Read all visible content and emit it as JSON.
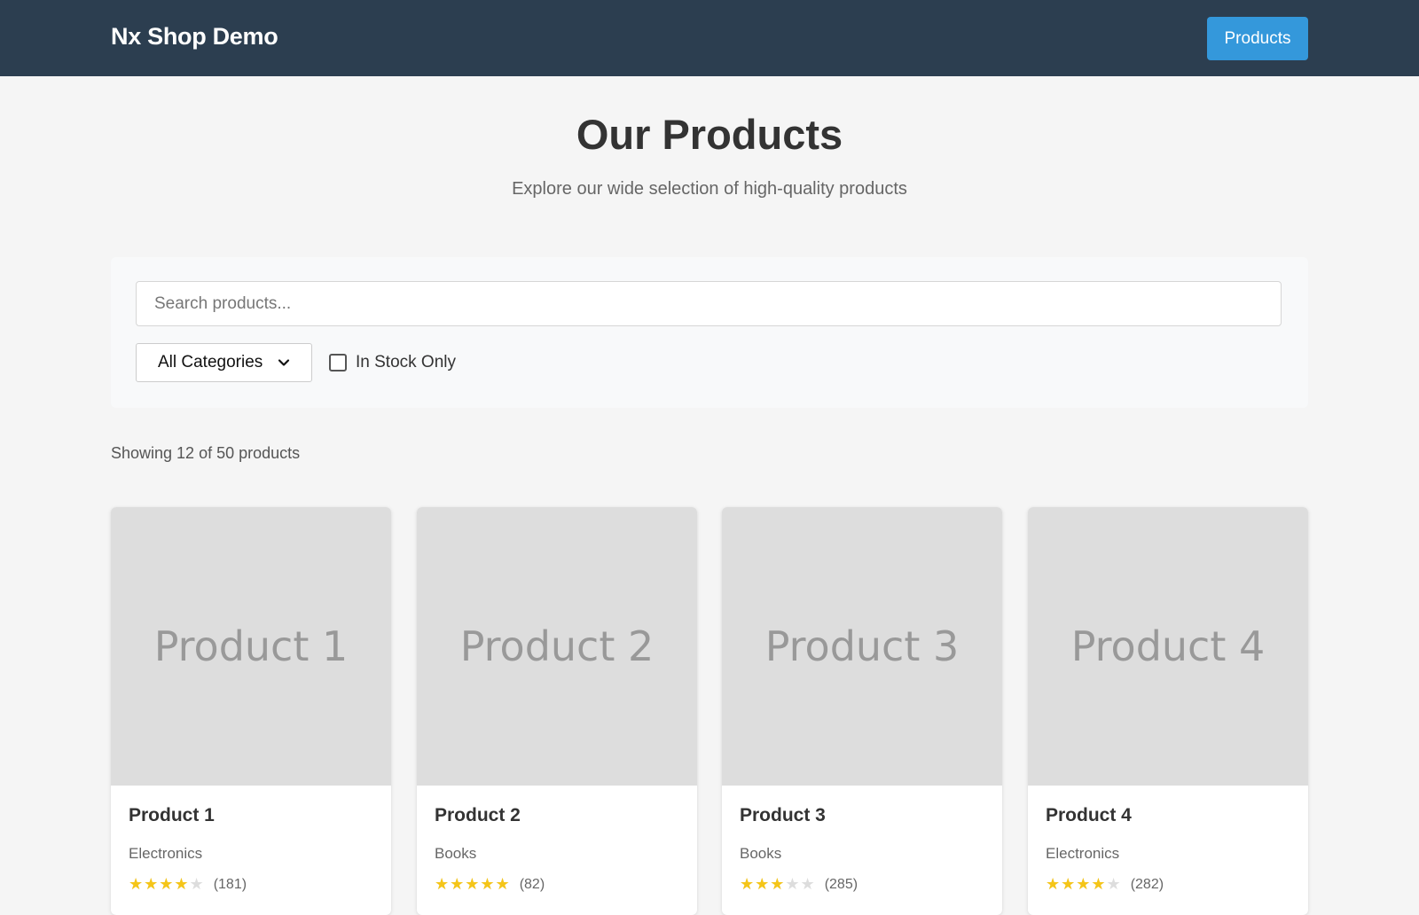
{
  "header": {
    "brand": "Nx Shop Demo",
    "nav_button": "Products"
  },
  "hero": {
    "title": "Our Products",
    "subtitle": "Explore our wide selection of high-quality products"
  },
  "filters": {
    "search_placeholder": "Search products...",
    "search_value": "",
    "category_selected": "All Categories",
    "in_stock_label": "In Stock Only",
    "in_stock_checked": false
  },
  "results": {
    "summary": "Showing 12 of 50 products"
  },
  "products": [
    {
      "image_label": "Product 1",
      "name": "Product 1",
      "category": "Electronics",
      "rating": 4,
      "reviews": "(181)"
    },
    {
      "image_label": "Product 2",
      "name": "Product 2",
      "category": "Books",
      "rating": 5,
      "reviews": "(82)"
    },
    {
      "image_label": "Product 3",
      "name": "Product 3",
      "category": "Books",
      "rating": 3,
      "reviews": "(285)"
    },
    {
      "image_label": "Product 4",
      "name": "Product 4",
      "category": "Electronics",
      "rating": 4,
      "reviews": "(282)"
    }
  ],
  "colors": {
    "header_bg": "#2c3e50",
    "accent": "#3498db",
    "star": "#f5c518",
    "placeholder_bg": "#dddddd"
  }
}
